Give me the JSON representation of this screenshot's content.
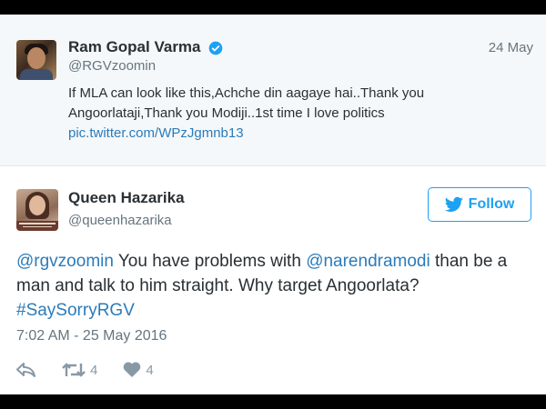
{
  "quoted_tweet": {
    "author_name": "Ram Gopal Varma",
    "author_handle": "@RGVzoomin",
    "date": "24 May",
    "verified_icon": "verified-badge-icon",
    "text_line1": "If MLA can look like this,Achche din aagaye hai..Thank you",
    "text_line2": "Angoorlataji,Thank you Modiji..1st time I love politics",
    "link": "pic.twitter.com/WPzJgmnb13"
  },
  "main_tweet": {
    "author_name": "Queen Hazarika",
    "author_handle": "@queenhazarika",
    "follow_label": "Follow",
    "line1_mention": "@rgvzoomin",
    "line1_text": " You have problems with ",
    "line1_mention2": "@narendramodi",
    "line1_tail": " than be a",
    "line2": "man and talk to him straight. Why target Angoorlata?",
    "hashtag": "#SaySorryRGV",
    "timestamp": "7:02 AM - 25 May 2016",
    "retweet_count": "4",
    "like_count": "4"
  },
  "colors": {
    "link": "#2b7bb9",
    "twitter_blue": "#1da1f2",
    "text": "#292f33",
    "muted": "#66757f"
  }
}
